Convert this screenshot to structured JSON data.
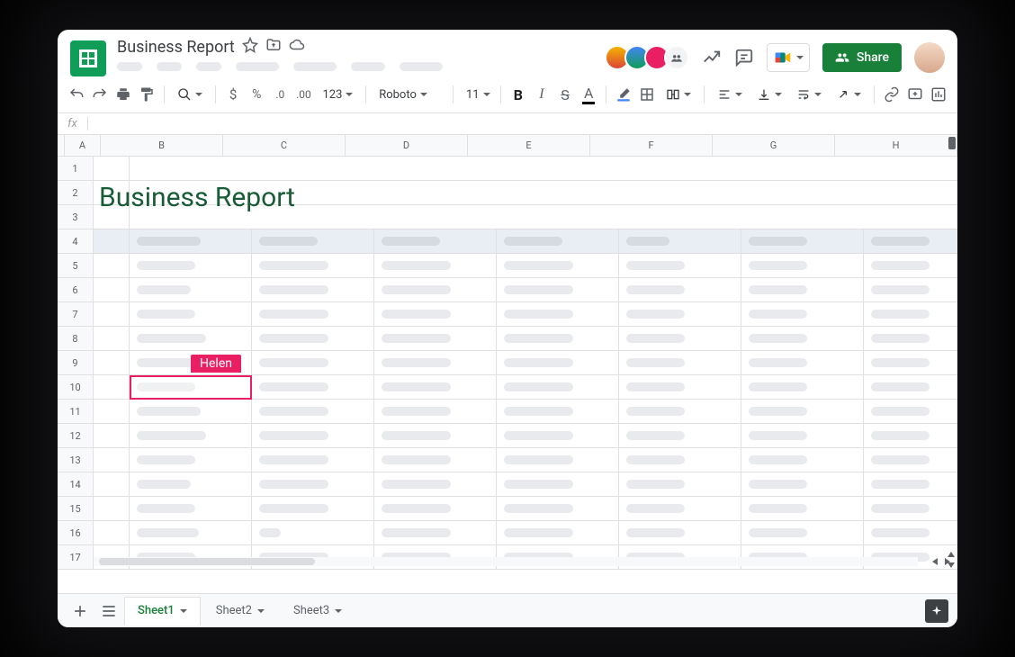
{
  "doc": {
    "title": "Business Report"
  },
  "share": {
    "label": "Share"
  },
  "toolbar": {
    "font": "Roboto",
    "fontsize": "11",
    "numfmt": "123"
  },
  "fx": {
    "label": "fx"
  },
  "columns": [
    "A",
    "B",
    "C",
    "D",
    "E",
    "F",
    "G",
    "H"
  ],
  "rows": [
    "1",
    "2",
    "3",
    "4",
    "5",
    "6",
    "7",
    "8",
    "9",
    "10",
    "11",
    "12",
    "13",
    "14",
    "15",
    "16",
    "17"
  ],
  "sheet_title": "Business Report",
  "collaborator": {
    "name": "Helen"
  },
  "tabs": [
    {
      "label": "Sheet1",
      "active": true
    },
    {
      "label": "Sheet2",
      "active": false
    },
    {
      "label": "Sheet3",
      "active": false
    }
  ],
  "colors": {
    "accent": "#188038",
    "collab": "#e91e63"
  }
}
